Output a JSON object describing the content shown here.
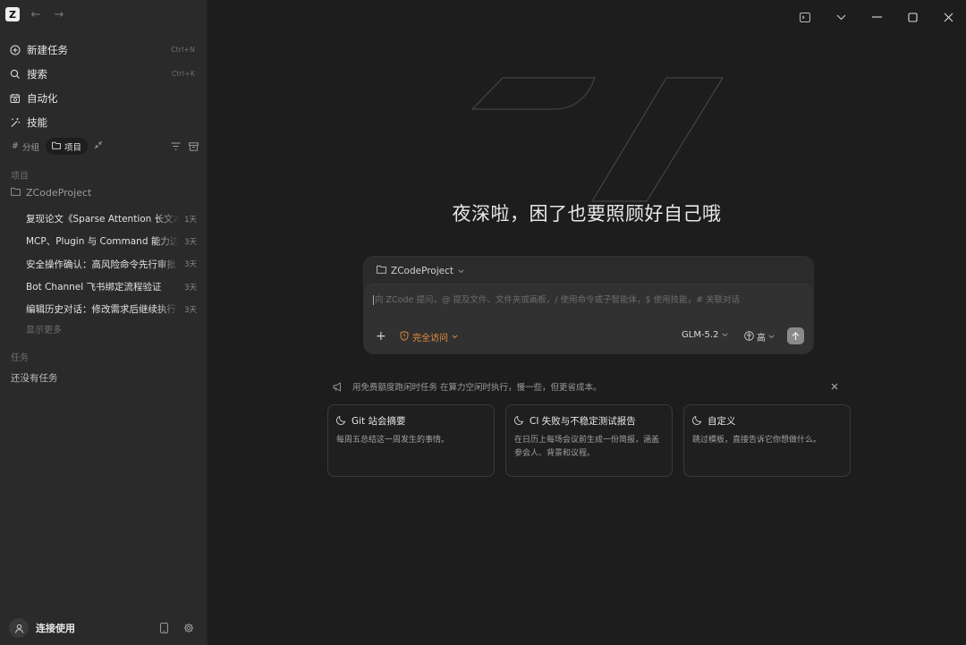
{
  "app": {
    "logo_letter": "Z"
  },
  "sidebar": {
    "menu": [
      {
        "label": "新建任务",
        "shortcut": "Ctrl+N",
        "icon": "plus-circle-icon"
      },
      {
        "label": "搜索",
        "shortcut": "Ctrl+K",
        "icon": "search-icon"
      },
      {
        "label": "自动化",
        "shortcut": "",
        "icon": "calendar-clock-icon"
      },
      {
        "label": "技能",
        "shortcut": "",
        "icon": "magic-wand-icon"
      }
    ],
    "filters": {
      "group_label": "分组",
      "project_label": "项目"
    },
    "projects_section_label": "项目",
    "project_name": "ZCodeProject",
    "tasks": [
      {
        "title": "复现论文《Sparse Attention 长文本",
        "age": "1天"
      },
      {
        "title": "MCP、Plugin 与 Command 能力边界",
        "age": "3天"
      },
      {
        "title": "安全操作确认：高风险命令先行审批",
        "age": "3天"
      },
      {
        "title": "Bot Channel 飞书绑定流程验证",
        "age": "3天"
      },
      {
        "title": "编辑历史对话：修改需求后继续执行",
        "age": "3天"
      }
    ],
    "show_more": "显示更多",
    "tasks_section_label": "任务",
    "no_tasks": "还没有任务",
    "footer": {
      "user_label": "连接使用"
    }
  },
  "main": {
    "greeting": "夜深啦，困了也要照顾好自己哦",
    "composer": {
      "project": "ZCodeProject",
      "placeholder": "向 ZCode 提问，@ 提及文件、文件夹或画板，/ 使用命令或子智能体，$ 使用技能，# 关联对话",
      "access_label": "完全访问",
      "model": "GLM-5.2",
      "effort": "高"
    },
    "tip": "用免费额度跑闲时任务 在算力空闲时执行，慢一些，但更省成本。",
    "cards": [
      {
        "title": "Git 站会摘要",
        "desc": "每周五总结这一周发生的事情。"
      },
      {
        "title": "CI 失败与不稳定测试报告",
        "desc": "在日历上每场会议前生成一份简报，涵盖参会人、背景和议程。"
      },
      {
        "title": "自定义",
        "desc": "跳过模板，直接告诉它你想做什么。"
      }
    ]
  },
  "colors": {
    "accent_orange": "#e8913a",
    "sidebar_bg": "#2a2a2a",
    "main_bg": "#1d1d1d"
  }
}
